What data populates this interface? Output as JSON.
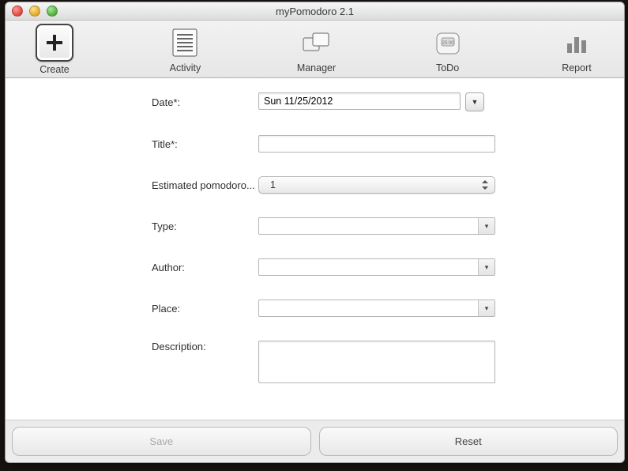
{
  "window": {
    "title": "myPomodoro 2.1"
  },
  "toolbar": {
    "items": [
      {
        "label": "Create",
        "icon": "plus-icon"
      },
      {
        "label": "Activity",
        "icon": "document-lines-icon"
      },
      {
        "label": "Manager",
        "icon": "stacked-panels-icon"
      },
      {
        "label": "ToDo",
        "icon": "timer-icon"
      },
      {
        "label": "Report",
        "icon": "bar-chart-icon"
      }
    ]
  },
  "form": {
    "date": {
      "label": "Date*:",
      "value": "Sun 11/25/2012"
    },
    "title": {
      "label": "Title*:",
      "value": ""
    },
    "estimated": {
      "label": "Estimated pomodoro...",
      "value": "1"
    },
    "type": {
      "label": "Type:",
      "value": ""
    },
    "author": {
      "label": "Author:",
      "value": ""
    },
    "place": {
      "label": "Place:",
      "value": ""
    },
    "description": {
      "label": "Description:",
      "value": ""
    }
  },
  "buttons": {
    "save": "Save",
    "reset": "Reset"
  }
}
